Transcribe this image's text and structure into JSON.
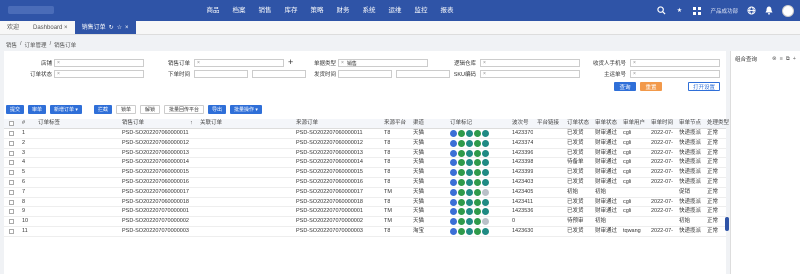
{
  "nav": {
    "items": [
      "商品",
      "档案",
      "销售",
      "库存",
      "策略",
      "财务",
      "系统",
      "运维",
      "监控",
      "报表"
    ],
    "user_text": "产品成功部"
  },
  "tabs": [
    {
      "label": "欢迎"
    },
    {
      "label": "Dashboard"
    },
    {
      "label": "销售订单"
    }
  ],
  "breadcrumb": [
    "销售",
    "订单管理",
    "销售订单"
  ],
  "filters": {
    "shop_label": "店铺",
    "sales_order_label": "销售订单",
    "order_type_label": "单据类型",
    "order_type_value": "销售",
    "logic_warehouse_label": "逻辑仓库",
    "receiver_phone_label": "收货人手机号",
    "order_status_label": "订单状态",
    "order_time_label": "下单时间",
    "ship_time_label": "发货时间",
    "sku_code_label": "SKU编码",
    "main_order_label": "主运单号",
    "query_label": "查询",
    "reset_label": "重置",
    "settings_label": "打开设置"
  },
  "toolbar": [
    "提交",
    "审单",
    "新增订单 ▾",
    "拦截",
    "锁单",
    "解锁",
    "批量回传平台",
    "导出",
    "批量操作 ▾"
  ],
  "side_panel": {
    "title": "组合查询"
  },
  "table": {
    "headers": [
      "#",
      "订单标签",
      "销售订单",
      "关联订单",
      "来源订单",
      "来源平台",
      "渠道",
      "订单标记",
      "波次号",
      "平台链接",
      "订单状态",
      "审单状态",
      "审单用户",
      "审单时间",
      "审单节点",
      "处理类型"
    ],
    "sort_asc": "↑",
    "rows": [
      {
        "n": "1",
        "so": "PSD-SO202207060000011",
        "src": "PSD-SO202207060000011",
        "plat": "T8",
        "ch": "天猫",
        "wave": "1423370",
        "status": "已发货",
        "audit": "财审通过",
        "user": "cgli",
        "time": "2022-07-",
        "node": "快递揽派",
        "type": "正常",
        "marks": [
          "blue",
          "green",
          "teal",
          "green",
          "teal"
        ]
      },
      {
        "n": "2",
        "so": "PSD-SO202207060000012",
        "src": "PSD-SO202207060000012",
        "plat": "T8",
        "ch": "天猫",
        "wave": "1423374",
        "status": "已发货",
        "audit": "财审通过",
        "user": "cgli",
        "time": "2022-07-",
        "node": "快递揽派",
        "type": "正常",
        "marks": [
          "blue",
          "green",
          "teal",
          "green",
          "teal"
        ]
      },
      {
        "n": "3",
        "so": "PSD-SO202207060000013",
        "src": "PSD-SO202207060000013",
        "plat": "T8",
        "ch": "天猫",
        "wave": "1423396",
        "status": "已发货",
        "audit": "财审通过",
        "user": "cgli",
        "time": "2022-07-",
        "node": "快递揽派",
        "type": "正常",
        "marks": [
          "blue",
          "green",
          "teal",
          "green",
          "teal"
        ]
      },
      {
        "n": "4",
        "so": "PSD-SO202207060000014",
        "src": "PSD-SO202207060000014",
        "plat": "T8",
        "ch": "天猫",
        "wave": "1423398",
        "status": "待备单",
        "audit": "财审通过",
        "user": "cgli",
        "time": "2022-07-",
        "node": "快递揽派",
        "type": "正常",
        "marks": [
          "blue",
          "green",
          "teal",
          "green",
          "teal"
        ]
      },
      {
        "n": "5",
        "so": "PSD-SO202207060000015",
        "src": "PSD-SO202207060000015",
        "plat": "T8",
        "ch": "天猫",
        "wave": "1423399",
        "status": "已发货",
        "audit": "财审通过",
        "user": "cgli",
        "time": "2022-07-",
        "node": "快递揽派",
        "type": "正常",
        "marks": [
          "blue",
          "green",
          "teal",
          "green",
          "teal"
        ]
      },
      {
        "n": "6",
        "so": "PSD-SO202207060000016",
        "src": "PSD-SO202207060000016",
        "plat": "T8",
        "ch": "天猫",
        "wave": "1423403",
        "status": "已发货",
        "audit": "财审通过",
        "user": "cgli",
        "time": "2022-07-",
        "node": "快递揽派",
        "type": "正常",
        "marks": [
          "blue",
          "green",
          "teal",
          "green",
          "teal"
        ]
      },
      {
        "n": "7",
        "so": "PSD-SO202207060000017",
        "src": "PSD-SO202207060000017",
        "plat": "TM",
        "ch": "天猫",
        "wave": "1423405",
        "status": "初始",
        "audit": "初始",
        "user": "",
        "time": "",
        "node": "促销",
        "type": "正常",
        "marks": [
          "blue",
          "green",
          "teal",
          "green",
          "gray"
        ]
      },
      {
        "n": "8",
        "so": "PSD-SO202207060000018",
        "src": "PSD-SO202207060000018",
        "plat": "T8",
        "ch": "天猫",
        "wave": "1423411",
        "status": "已发货",
        "audit": "财审通过",
        "user": "cgli",
        "time": "2022-07-",
        "node": "快递揽派",
        "type": "正常",
        "marks": [
          "blue",
          "green",
          "teal",
          "green",
          "teal"
        ]
      },
      {
        "n": "9",
        "so": "PSD-SO202207070000001",
        "src": "PSD-SO202207070000001",
        "plat": "TM",
        "ch": "天猫",
        "wave": "1423536",
        "status": "已发货",
        "audit": "财审通过",
        "user": "cgli",
        "time": "2022-07-",
        "node": "快递揽派",
        "type": "正常",
        "marks": [
          "blue",
          "green",
          "teal",
          "green",
          "teal"
        ]
      },
      {
        "n": "10",
        "so": "PSD-SO202207070000002",
        "src": "PSD-SO202207070000002",
        "plat": "TM",
        "ch": "天猫",
        "wave": "0",
        "status": "待预审",
        "audit": "初始",
        "user": "",
        "time": "",
        "node": "初始",
        "type": "正常",
        "marks": [
          "blue",
          "green",
          "teal",
          "green",
          "gray"
        ]
      },
      {
        "n": "11",
        "so": "PSD-SO202207070000003",
        "src": "PSD-SO202207070000003",
        "plat": "T8",
        "ch": "淘宝",
        "wave": "1423630",
        "status": "已发货",
        "audit": "财审通过",
        "user": "tqwang",
        "time": "2022-07-",
        "node": "快递揽派",
        "type": "正常",
        "marks": [
          "blue",
          "green",
          "teal",
          "green",
          "teal"
        ]
      }
    ]
  }
}
